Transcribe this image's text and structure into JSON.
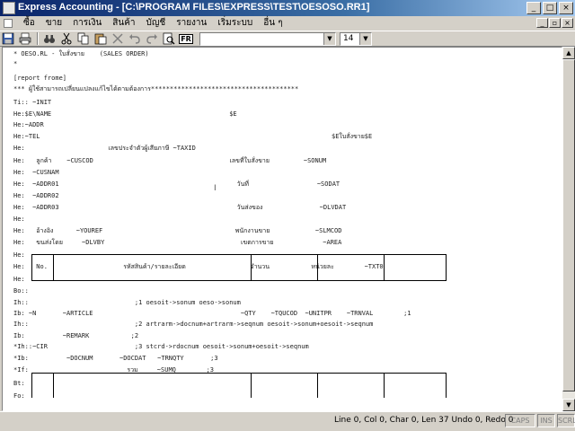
{
  "window": {
    "title": "Express Accounting - [C:\\PROGRAM FILES\\EXPRESS\\TEST\\OESOSO.RR1]"
  },
  "menu": [
    "ซื้อ",
    "ขาย",
    "การเงิน",
    "สินค้า",
    "บัญชี",
    "รายงาน",
    "เริ่มระบบ",
    "อื่น ๆ"
  ],
  "toolbar": {
    "icons": [
      "save-icon",
      "print-icon",
      "binoculars-icon",
      "cut-icon",
      "copy-icon",
      "paste-icon",
      "delete-icon",
      "undo-icon",
      "redo-icon",
      "find-icon",
      "find-replace-icon"
    ],
    "fr_label": "FR",
    "font_value": "",
    "size_value": "14"
  },
  "editor": {
    "lines": [
      "* OESO.RL - ใบสั่งขาย    (SALES ORDER)",
      "*",
      "",
      "[report frome]",
      "*** ผู้ใช้สามารถเปลี่ยนแปลงแก้ไขได้ตามต้องการ***************************************",
      "Ti:: ~INIT",
      "He:$E\\NAME                                               $E",
      "He:~ADDR",
      "He:~TEL                                                                             $Eใบสั่งขาย$E",
      "He:                      เลขประจำตัวผู้เสียภาษี ~TAXID",
      "He:   ลูกค้า    ~CUSCOD                                    เลขที่ใบสั่งขาย         ~SONUM",
      "He:  ~CUSNAM",
      "He:  ~ADDR01                                               วันที่                  ~SODAT",
      "He:  ~ADDR02",
      "He:  ~ADDR03                                               วันส่งของ               ~DLVDAT",
      "He:",
      "He:   อ้างอิง      ~YOUREF                                   พนักงานขาย            ~SLMCOD",
      "He:   ขนส่งโดย     ~DLVBY                                    เขตการขาย             ~AREA",
      "He:",
      "He:   No.                    รหัสสินค้า/รายละเอียด                 จำนวน           หน่วยละ        ~TXT0",
      "He:",
      "Bo::",
      "Ih::                            ;1 oesoit->sonum oeso->sonum",
      "Ib: ~N       ~ARTICLE                                       ~QTY    ~TQUCOD  ~UNITPR    ~TRNVAL        ;1",
      "Ih::                            ;2 artrarm->docnum+artrarm->seqnum oesoit->sonum+oesoit->seqnum",
      "Ib:          ~REMARK           ;2",
      "*Ih::~CIR                       ;3 stcrd->rdocnum oesoit->sonum+oesoit->seqnum",
      "*Ib:          ~DOCNUM       ~DOCDAT   ~TRNQTY       ;3",
      "*If:                          รวม     ~SUMQ        ;3",
      "Bt:",
      "Fo:"
    ]
  },
  "status": {
    "position": "Line 0, Col 0, Char 0, Len 37 Undo 0, Redo 0",
    "caps": "CAPS",
    "ins": "INS",
    "scrl": "SCRL"
  }
}
